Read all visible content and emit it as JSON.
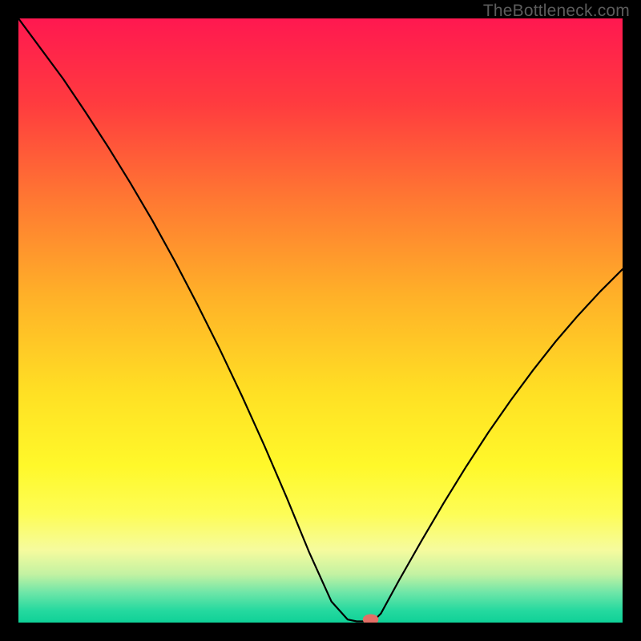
{
  "watermark": "TheBottleneck.com",
  "chart_data": {
    "type": "line",
    "title": "",
    "xlabel": "",
    "ylabel": "",
    "xlim": [
      0,
      100
    ],
    "ylim": [
      0,
      100
    ],
    "background_gradient": {
      "stops": [
        {
          "offset": 0,
          "color": "#ff1850"
        },
        {
          "offset": 14,
          "color": "#ff3b3f"
        },
        {
          "offset": 30,
          "color": "#ff7832"
        },
        {
          "offset": 46,
          "color": "#ffb128"
        },
        {
          "offset": 62,
          "color": "#ffe024"
        },
        {
          "offset": 74,
          "color": "#fff82a"
        },
        {
          "offset": 82,
          "color": "#fdfd56"
        },
        {
          "offset": 88,
          "color": "#f6fb9e"
        },
        {
          "offset": 92,
          "color": "#c3f2a2"
        },
        {
          "offset": 95,
          "color": "#6fe6a8"
        },
        {
          "offset": 98,
          "color": "#25d99f"
        },
        {
          "offset": 100,
          "color": "#0fd197"
        }
      ]
    },
    "series": [
      {
        "name": "bottleneck-curve",
        "color": "#000000",
        "x": [
          0.0,
          3.7,
          7.4,
          11.1,
          14.8,
          18.5,
          22.2,
          25.9,
          29.6,
          33.3,
          37.0,
          40.7,
          44.4,
          48.1,
          51.8,
          54.5,
          56.0,
          57.5,
          59.0,
          60.0,
          63.0,
          66.7,
          70.4,
          74.1,
          77.8,
          81.5,
          85.2,
          88.9,
          92.6,
          96.3,
          100.0
        ],
        "y": [
          100.0,
          95.0,
          90.0,
          84.5,
          78.8,
          72.8,
          66.5,
          59.8,
          52.7,
          45.3,
          37.5,
          29.3,
          20.7,
          11.7,
          3.5,
          0.5,
          0.2,
          0.2,
          0.5,
          1.5,
          7.0,
          13.5,
          19.8,
          25.8,
          31.5,
          36.8,
          41.8,
          46.5,
          50.8,
          54.8,
          58.5
        ]
      }
    ],
    "marker": {
      "name": "current-point",
      "x": 58.3,
      "y": 0.5,
      "color": "#e36f66",
      "rx": 1.3,
      "ry": 0.9
    }
  }
}
